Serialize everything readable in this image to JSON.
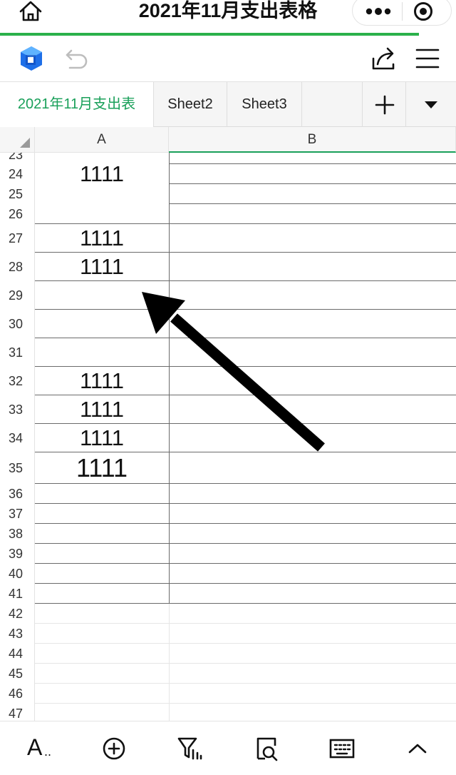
{
  "window": {
    "title": "2021年11月支出表格"
  },
  "colors": {
    "accent": "#1aa05a",
    "progress": "#2bb14a"
  },
  "tabs": [
    {
      "label": "2021年11月支出表",
      "active": true
    },
    {
      "label": "Sheet2",
      "active": false
    },
    {
      "label": "Sheet3",
      "active": false
    }
  ],
  "columns": [
    "A",
    "B"
  ],
  "rows": [
    {
      "num": "23",
      "value": ""
    },
    {
      "num": "24",
      "value": "1111"
    },
    {
      "num": "25",
      "value": ""
    },
    {
      "num": "26",
      "value": ""
    },
    {
      "num": "27",
      "value": "1111"
    },
    {
      "num": "28",
      "value": "1111"
    },
    {
      "num": "29",
      "value": ""
    },
    {
      "num": "30",
      "value": ""
    },
    {
      "num": "31",
      "value": ""
    },
    {
      "num": "32",
      "value": "1111"
    },
    {
      "num": "33",
      "value": "1111"
    },
    {
      "num": "34",
      "value": "1111"
    },
    {
      "num": "35",
      "value": "1111"
    },
    {
      "num": "36",
      "value": ""
    },
    {
      "num": "37",
      "value": ""
    },
    {
      "num": "38",
      "value": ""
    },
    {
      "num": "39",
      "value": ""
    },
    {
      "num": "40",
      "value": ""
    },
    {
      "num": "41",
      "value": ""
    },
    {
      "num": "42",
      "value": ""
    },
    {
      "num": "43",
      "value": ""
    },
    {
      "num": "44",
      "value": ""
    },
    {
      "num": "45",
      "value": ""
    },
    {
      "num": "46",
      "value": ""
    },
    {
      "num": "47",
      "value": ""
    }
  ],
  "bottombar": {
    "font_label": "A",
    "font_suffix": "..",
    "icons": [
      "font-icon",
      "add-circle-icon",
      "filter-sort-icon",
      "find-icon",
      "keyboard-icon",
      "chevron-up-icon"
    ]
  },
  "toolbar_icons": [
    "home-icon",
    "more-dots-icon",
    "target-icon",
    "app-logo-icon",
    "undo-icon",
    "share-icon",
    "hamburger-menu-icon",
    "plus-icon",
    "triangle-down-icon"
  ]
}
